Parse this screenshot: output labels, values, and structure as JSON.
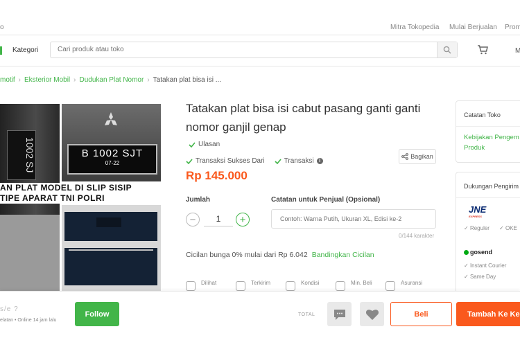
{
  "topbar": {
    "left": "o",
    "links": [
      "Mitra Tokopedia",
      "Mulai Berjualan",
      "Prom"
    ]
  },
  "header": {
    "kategori": "Kategori",
    "search_placeholder": "Cari produk atau toko",
    "masuk": "M"
  },
  "breadcrumb": {
    "items": [
      "motif",
      "Eksterior Mobil",
      "Dudukan Plat Nomor"
    ],
    "current": "Tatakan plat bisa isi ..."
  },
  "photos": {
    "plate_main": "B 1002 SJT",
    "plate_date": "07-22",
    "overlay_line1": "AN PLAT MODEL DI SLIP SISIP",
    "overlay_line2": "TIPE APARAT TNI POLRI",
    "side_plate": "1002 SJ"
  },
  "product": {
    "title": "Tatakan plat bisa isi cabut pasang ganti ganti nomor ganjil genap",
    "ulasan": "Ulasan",
    "transaksi_sukses": "Transaksi Sukses Dari",
    "transaksi": "Transaksi",
    "bagikan": "Bagikan",
    "price": "Rp 145.000",
    "jumlah_label": "Jumlah",
    "quantity": "1",
    "catatan_label": "Catatan untuk Penjual (Opsional)",
    "catatan_placeholder": "Contoh: Warna Putih, Ukuran XL, Edisi ke-2",
    "char_count": "0/144 karakter",
    "cicilan_text": "Cicilan bunga 0% mulai dari Rp 6.042",
    "cicilan_link": "Bandingkan Cicilan",
    "stats": [
      "Dilihat",
      "Terkirim",
      "Kondisi",
      "Min. Beli",
      "Asuransi"
    ]
  },
  "sidebar": {
    "catatan_toko": "Catatan Toko",
    "kebijakan": "Kebijakan Pengem",
    "produk": "Produk",
    "dukungan": "Dukungan Pengirim",
    "jne": "JNE",
    "jne_services": [
      "Reguler",
      "OKE"
    ],
    "gosend": "gosend",
    "gosend_services": [
      "Instant Courier",
      "Same Day"
    ]
  },
  "bottombar": {
    "shop_name": "s/e    ?",
    "shop_info": "elatan • Online 14 jam lalu",
    "follow": "Follow",
    "total": "TOTAL",
    "beli": "Beli",
    "tambah": "Tambah Ke Ke"
  },
  "colors": {
    "brand_green": "#42b549",
    "price_orange": "#fa591d"
  }
}
